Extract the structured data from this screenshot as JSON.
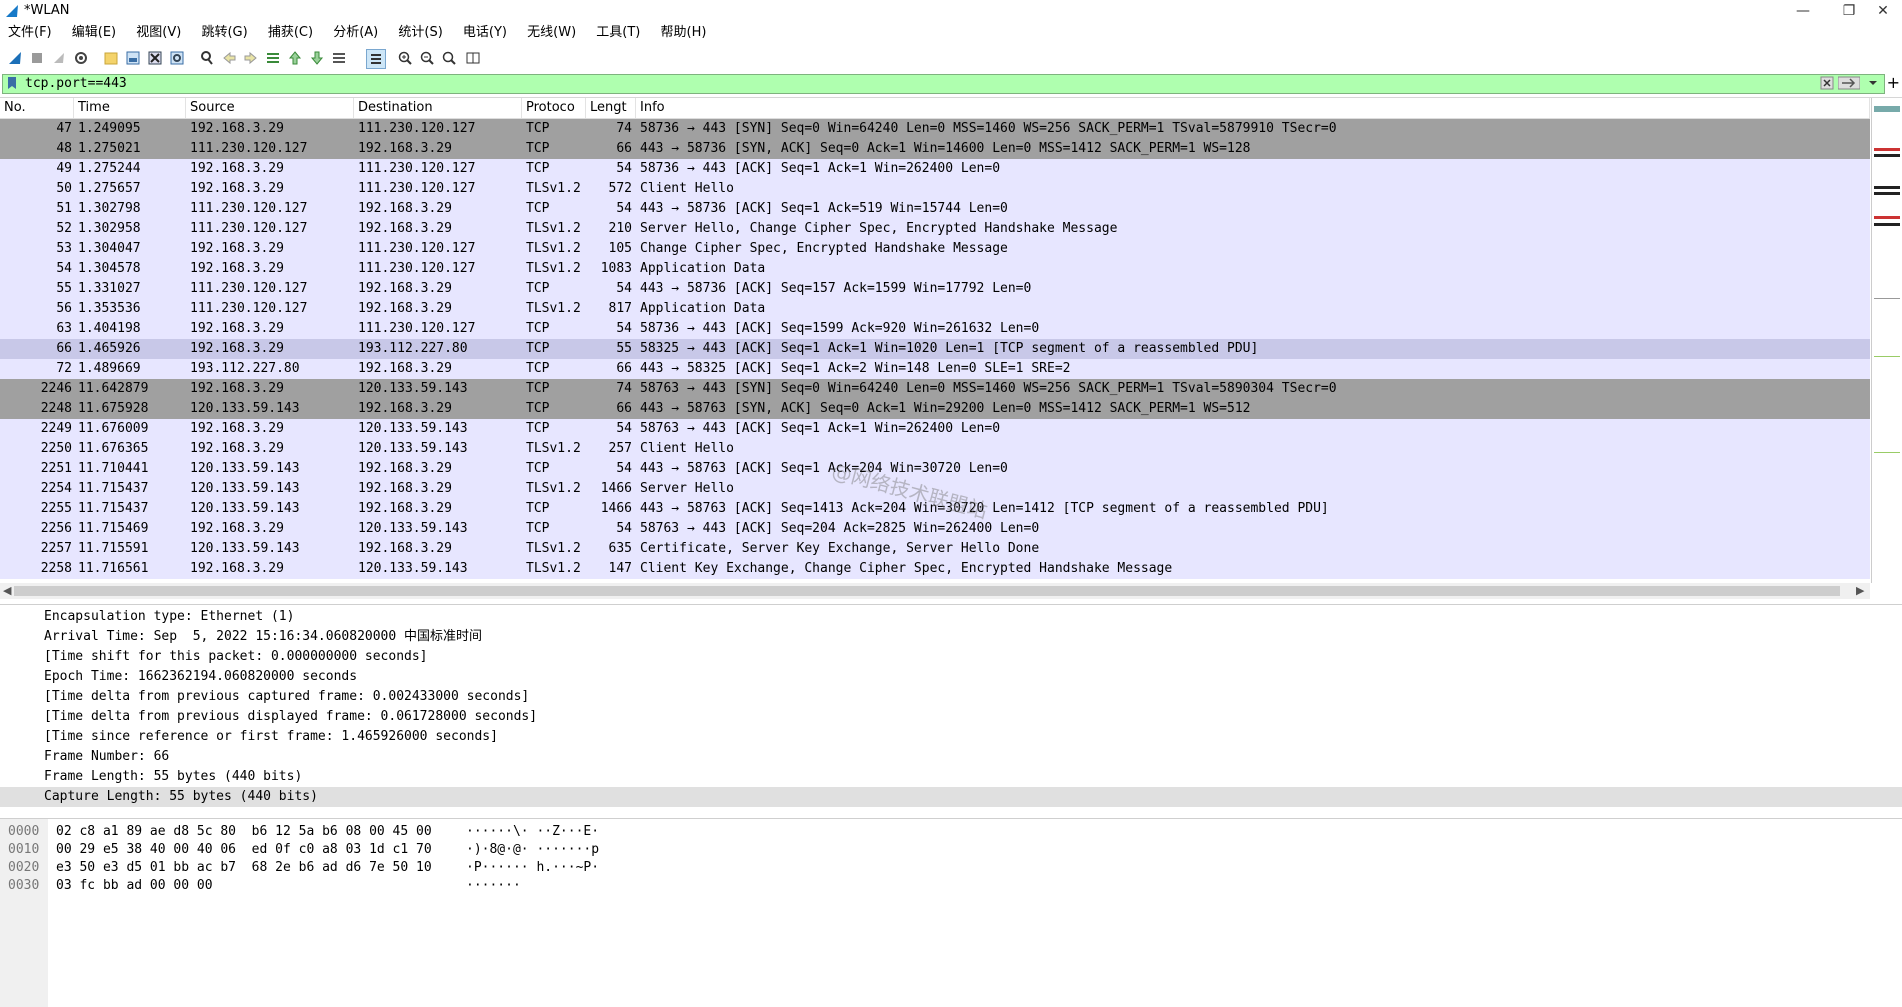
{
  "window": {
    "title": "*WLAN",
    "minimize": "—",
    "restore": "❐",
    "close": "✕"
  },
  "menu": [
    "文件(F)",
    "编辑(E)",
    "视图(V)",
    "跳转(G)",
    "捕获(C)",
    "分析(A)",
    "统计(S)",
    "电话(Y)",
    "无线(W)",
    "工具(T)",
    "帮助(H)"
  ],
  "filter": {
    "value": "tcp.port==443",
    "plus": "+"
  },
  "columns": {
    "no": "No.",
    "time": "Time",
    "source": "Source",
    "destination": "Destination",
    "protocol": "Protoco",
    "length": "Lengt",
    "info": "Info"
  },
  "packets": [
    {
      "no": "47",
      "time": "1.249095",
      "src": "192.168.3.29",
      "dst": "111.230.120.127",
      "proto": "TCP",
      "len": "74",
      "info": "58736 → 443 [SYN] Seq=0 Win=64240 Len=0 MSS=1460 WS=256 SACK_PERM=1 TSval=5879910 TSecr=0",
      "style": "syn"
    },
    {
      "no": "48",
      "time": "1.275021",
      "src": "111.230.120.127",
      "dst": "192.168.3.29",
      "proto": "TCP",
      "len": "66",
      "info": "443 → 58736 [SYN, ACK] Seq=0 Ack=1 Win=14600 Len=0 MSS=1412 SACK_PERM=1 WS=128",
      "style": "syn"
    },
    {
      "no": "49",
      "time": "1.275244",
      "src": "192.168.3.29",
      "dst": "111.230.120.127",
      "proto": "TCP",
      "len": "54",
      "info": "58736 → 443 [ACK] Seq=1 Ack=1 Win=262400 Len=0",
      "style": "normal"
    },
    {
      "no": "50",
      "time": "1.275657",
      "src": "192.168.3.29",
      "dst": "111.230.120.127",
      "proto": "TLSv1.2",
      "len": "572",
      "info": "Client Hello",
      "style": "normal"
    },
    {
      "no": "51",
      "time": "1.302798",
      "src": "111.230.120.127",
      "dst": "192.168.3.29",
      "proto": "TCP",
      "len": "54",
      "info": "443 → 58736 [ACK] Seq=1 Ack=519 Win=15744 Len=0",
      "style": "normal"
    },
    {
      "no": "52",
      "time": "1.302958",
      "src": "111.230.120.127",
      "dst": "192.168.3.29",
      "proto": "TLSv1.2",
      "len": "210",
      "info": "Server Hello, Change Cipher Spec, Encrypted Handshake Message",
      "style": "normal"
    },
    {
      "no": "53",
      "time": "1.304047",
      "src": "192.168.3.29",
      "dst": "111.230.120.127",
      "proto": "TLSv1.2",
      "len": "105",
      "info": "Change Cipher Spec, Encrypted Handshake Message",
      "style": "normal"
    },
    {
      "no": "54",
      "time": "1.304578",
      "src": "192.168.3.29",
      "dst": "111.230.120.127",
      "proto": "TLSv1.2",
      "len": "1083",
      "info": "Application Data",
      "style": "normal"
    },
    {
      "no": "55",
      "time": "1.331027",
      "src": "111.230.120.127",
      "dst": "192.168.3.29",
      "proto": "TCP",
      "len": "54",
      "info": "443 → 58736 [ACK] Seq=157 Ack=1599 Win=17792 Len=0",
      "style": "normal"
    },
    {
      "no": "56",
      "time": "1.353536",
      "src": "111.230.120.127",
      "dst": "192.168.3.29",
      "proto": "TLSv1.2",
      "len": "817",
      "info": "Application Data",
      "style": "normal"
    },
    {
      "no": "63",
      "time": "1.404198",
      "src": "192.168.3.29",
      "dst": "111.230.120.127",
      "proto": "TCP",
      "len": "54",
      "info": "58736 → 443 [ACK] Seq=1599 Ack=920 Win=261632 Len=0",
      "style": "normal"
    },
    {
      "no": "66",
      "time": "1.465926",
      "src": "192.168.3.29",
      "dst": "193.112.227.80",
      "proto": "TCP",
      "len": "55",
      "info": "58325 → 443 [ACK] Seq=1 Ack=1 Win=1020 Len=1 [TCP segment of a reassembled PDU]",
      "style": "selected"
    },
    {
      "no": "72",
      "time": "1.489669",
      "src": "193.112.227.80",
      "dst": "192.168.3.29",
      "proto": "TCP",
      "len": "66",
      "info": "443 → 58325 [ACK] Seq=1 Ack=2 Win=148 Len=0 SLE=1 SRE=2",
      "style": "normal"
    },
    {
      "no": "2246",
      "time": "11.642879",
      "src": "192.168.3.29",
      "dst": "120.133.59.143",
      "proto": "TCP",
      "len": "74",
      "info": "58763 → 443 [SYN] Seq=0 Win=64240 Len=0 MSS=1460 WS=256 SACK_PERM=1 TSval=5890304 TSecr=0",
      "style": "syn"
    },
    {
      "no": "2248",
      "time": "11.675928",
      "src": "120.133.59.143",
      "dst": "192.168.3.29",
      "proto": "TCP",
      "len": "66",
      "info": "443 → 58763 [SYN, ACK] Seq=0 Ack=1 Win=29200 Len=0 MSS=1412 SACK_PERM=1 WS=512",
      "style": "syn"
    },
    {
      "no": "2249",
      "time": "11.676009",
      "src": "192.168.3.29",
      "dst": "120.133.59.143",
      "proto": "TCP",
      "len": "54",
      "info": "58763 → 443 [ACK] Seq=1 Ack=1 Win=262400 Len=0",
      "style": "normal"
    },
    {
      "no": "2250",
      "time": "11.676365",
      "src": "192.168.3.29",
      "dst": "120.133.59.143",
      "proto": "TLSv1.2",
      "len": "257",
      "info": "Client Hello",
      "style": "normal"
    },
    {
      "no": "2251",
      "time": "11.710441",
      "src": "120.133.59.143",
      "dst": "192.168.3.29",
      "proto": "TCP",
      "len": "54",
      "info": "443 → 58763 [ACK] Seq=1 Ack=204 Win=30720 Len=0",
      "style": "normal"
    },
    {
      "no": "2254",
      "time": "11.715437",
      "src": "120.133.59.143",
      "dst": "192.168.3.29",
      "proto": "TLSv1.2",
      "len": "1466",
      "info": "Server Hello",
      "style": "normal"
    },
    {
      "no": "2255",
      "time": "11.715437",
      "src": "120.133.59.143",
      "dst": "192.168.3.29",
      "proto": "TCP",
      "len": "1466",
      "info": "443 → 58763 [ACK] Seq=1413 Ack=204 Win=30720 Len=1412 [TCP segment of a reassembled PDU]",
      "style": "normal"
    },
    {
      "no": "2256",
      "time": "11.715469",
      "src": "192.168.3.29",
      "dst": "120.133.59.143",
      "proto": "TCP",
      "len": "54",
      "info": "58763 → 443 [ACK] Seq=204 Ack=2825 Win=262400 Len=0",
      "style": "normal"
    },
    {
      "no": "2257",
      "time": "11.715591",
      "src": "120.133.59.143",
      "dst": "192.168.3.29",
      "proto": "TLSv1.2",
      "len": "635",
      "info": "Certificate, Server Key Exchange, Server Hello Done",
      "style": "normal"
    },
    {
      "no": "2258",
      "time": "11.716561",
      "src": "192.168.3.29",
      "dst": "120.133.59.143",
      "proto": "TLSv1.2",
      "len": "147",
      "info": "Client Key Exchange, Change Cipher Spec, Encrypted Handshake Message",
      "style": "normal"
    }
  ],
  "details": [
    "Encapsulation type: Ethernet (1)",
    "Arrival Time: Sep  5, 2022 15:16:34.060820000 中国标准时间",
    "[Time shift for this packet: 0.000000000 seconds]",
    "Epoch Time: 1662362194.060820000 seconds",
    "[Time delta from previous captured frame: 0.002433000 seconds]",
    "[Time delta from previous displayed frame: 0.061728000 seconds]",
    "[Time since reference or first frame: 1.465926000 seconds]",
    "Frame Number: 66",
    "Frame Length: 55 bytes (440 bits)",
    "Capture Length: 55 bytes (440 bits)"
  ],
  "bytes": [
    {
      "offset": "0000",
      "hex": "02 c8 a1 89 ae d8 5c 80  b6 12 5a b6 08 00 45 00",
      "ascii": "······\\· ··Z···E·"
    },
    {
      "offset": "0010",
      "hex": "00 29 e5 38 40 00 40 06  ed 0f c0 a8 03 1d c1 70",
      "ascii": "·)·8@·@· ·······p"
    },
    {
      "offset": "0020",
      "hex": "e3 50 e3 d5 01 bb ac b7  68 2e b6 ad d6 7e 50 10",
      "ascii": "·P······ h.···~P·"
    },
    {
      "offset": "0030",
      "hex": "03 fc bb ad 00 00 00",
      "ascii": "·······"
    }
  ],
  "watermark": "@网络技术联盟站",
  "colors": {
    "syn_row": "#a0a0a0",
    "normal_row": "#e7e6ff",
    "selected_row": "#c8c8e8",
    "filter_bg": "#afffaf",
    "selected_detail": "#e0e0e0"
  }
}
